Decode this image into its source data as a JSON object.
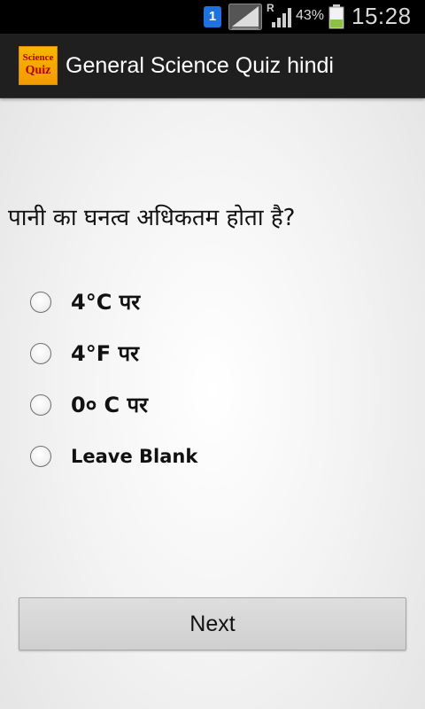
{
  "status_bar": {
    "notification_badge": "1",
    "roaming": "R",
    "battery_percent": "43%",
    "battery_level": 0.43,
    "time": "15:28",
    "colors": {
      "notification": "#1d72e0",
      "battery_fill": "#8ac43f"
    }
  },
  "action_bar": {
    "logo_line1": "Science",
    "logo_line2": "Quiz",
    "title": "General Science Quiz hindi"
  },
  "quiz": {
    "question": "पानी का घनत्व अधिकतम होता है?",
    "options": [
      {
        "label": "4°C पर",
        "selected": false
      },
      {
        "label": "4°F पर",
        "selected": false
      },
      {
        "label": "0० C पर",
        "selected": false
      },
      {
        "label": "Leave Blank",
        "selected": false
      }
    ],
    "next_label": "Next"
  }
}
